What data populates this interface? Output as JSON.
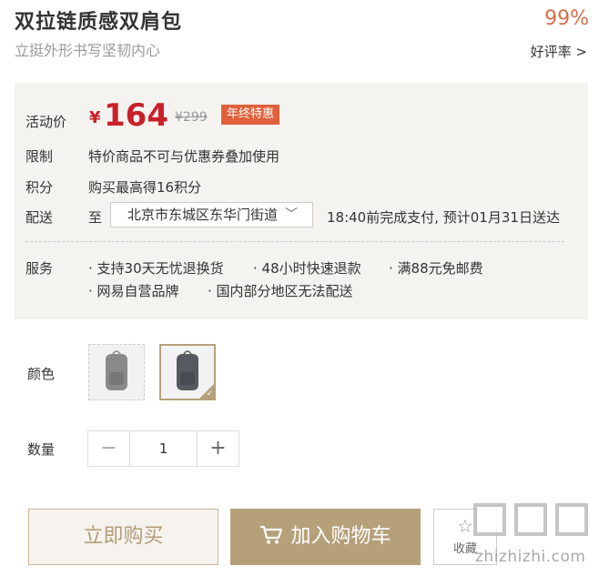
{
  "product": {
    "title": "双拉链质感双肩包",
    "subtitle": "立挺外形书写坚韧内心"
  },
  "rating": {
    "value": "99%",
    "link_label": "好评率 >"
  },
  "price": {
    "label": "活动价",
    "currency": "¥",
    "current": "164",
    "original": "¥299",
    "badge": "年终特惠"
  },
  "limit": {
    "label": "限制",
    "text": "特价商品不可与优惠券叠加使用"
  },
  "points": {
    "label": "积分",
    "text": "购买最高得16积分"
  },
  "delivery": {
    "label": "配送",
    "to": "至",
    "region": "北京市东城区东华门街道",
    "note": "18:40前完成支付, 预计01月31日送达"
  },
  "service": {
    "label": "服务",
    "items": [
      "· 支持30天无忧退换货",
      "· 48小时快速退款",
      "· 满88元免邮费",
      "· 网易自营品牌",
      "· 国内部分地区无法配送"
    ]
  },
  "color": {
    "label": "颜色",
    "selected_index": 1
  },
  "quantity": {
    "label": "数量",
    "value": "1",
    "minus": "−",
    "plus": "+"
  },
  "actions": {
    "buy_now": "立即购买",
    "add_to_cart": "加入购物车",
    "favorite": "收藏"
  },
  "watermark": {
    "text": "zhizhizhi.com"
  },
  "colors": {
    "accent": "#b6a07a",
    "price": "#c9202a",
    "badge": "#e0603c",
    "rating": "#d4704a"
  }
}
